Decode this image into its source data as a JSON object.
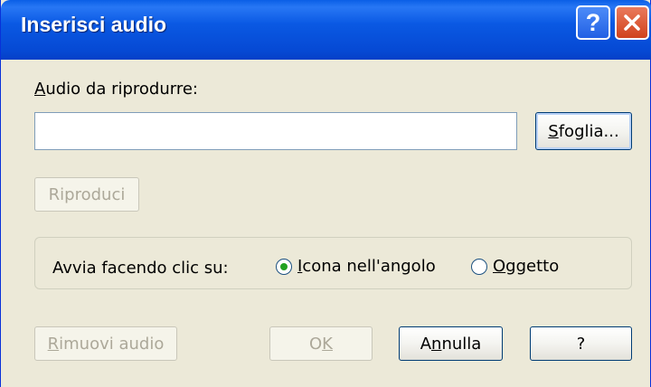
{
  "window": {
    "title": "Inserisci audio",
    "help_glyph": "?"
  },
  "audio_label": {
    "accel": "A",
    "rest": "udio da riprodurre:"
  },
  "path_input": {
    "value": ""
  },
  "browse_button": {
    "accel": "S",
    "rest": "foglia..."
  },
  "play_button": {
    "label": "Riproduci",
    "enabled": false
  },
  "start_group": {
    "label": "Avvia facendo clic su:",
    "options": [
      {
        "accel": "I",
        "rest": "cona nell'angolo",
        "checked": true
      },
      {
        "accel": "O",
        "rest": "ggetto",
        "checked": false
      }
    ]
  },
  "remove_button": {
    "accel": "R",
    "rest": "imuovi audio",
    "enabled": false
  },
  "ok_button": {
    "pre": "O",
    "accel": "K",
    "enabled": false
  },
  "cancel_button": {
    "pre": "A",
    "accel": "n",
    "rest": "nulla"
  },
  "help_button": {
    "label": "?"
  }
}
